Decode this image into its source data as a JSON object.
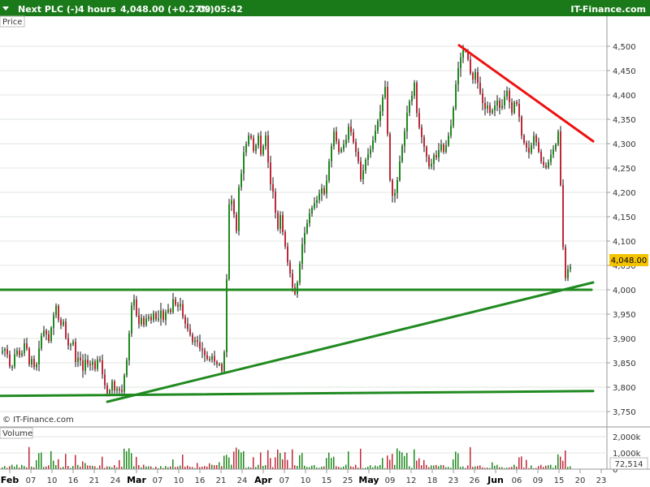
{
  "header": {
    "instrument": "Next PLC (-)",
    "timeframe": "4 hours",
    "last_change": "4,048.00 (+0.27%)",
    "time": "09:05:42",
    "brand": "IT-Finance.com"
  },
  "price_panel_label": "Price",
  "volume_panel_label": "Volume",
  "watermark": "© IT-Finance.com",
  "last_price_label": "4,048.00",
  "last_volume_label": "72,514",
  "price_ticks": [
    "4,500",
    "4,450",
    "4,400",
    "4,350",
    "4,300",
    "4,250",
    "4,200",
    "4,150",
    "4,100",
    "4,050",
    "4,000",
    "3,950",
    "3,900",
    "3,850",
    "3,800",
    "3,750"
  ],
  "volume_ticks": [
    "2,000k",
    "1,000k",
    "0"
  ],
  "x_ticks": [
    {
      "label": "Feb",
      "bold": true
    },
    {
      "label": "07",
      "bold": false
    },
    {
      "label": "10",
      "bold": false
    },
    {
      "label": "16",
      "bold": false
    },
    {
      "label": "21",
      "bold": false
    },
    {
      "label": "24",
      "bold": false
    },
    {
      "label": "Mar",
      "bold": true
    },
    {
      "label": "07",
      "bold": false
    },
    {
      "label": "10",
      "bold": false
    },
    {
      "label": "16",
      "bold": false
    },
    {
      "label": "21",
      "bold": false
    },
    {
      "label": "24",
      "bold": false
    },
    {
      "label": "Apr",
      "bold": true
    },
    {
      "label": "07",
      "bold": false
    },
    {
      "label": "10",
      "bold": false
    },
    {
      "label": "15",
      "bold": false
    },
    {
      "label": "25",
      "bold": false
    },
    {
      "label": "May",
      "bold": true
    },
    {
      "label": "09",
      "bold": false
    },
    {
      "label": "12",
      "bold": false
    },
    {
      "label": "18",
      "bold": false
    },
    {
      "label": "23",
      "bold": false
    },
    {
      "label": "26",
      "bold": false
    },
    {
      "label": "Jun",
      "bold": true
    },
    {
      "label": "06",
      "bold": false
    },
    {
      "label": "09",
      "bold": false
    },
    {
      "label": "15",
      "bold": false
    },
    {
      "label": "20",
      "bold": false
    },
    {
      "label": "23",
      "bold": false
    }
  ],
  "colors": {
    "header_bg": "#1a7a1a",
    "up_candle": "#1e8a1e",
    "down_candle": "#c0283a",
    "trendline_green": "#208a20",
    "trendline_red": "#ee1111",
    "last_price_bg": "#f5c400",
    "grid": "#dfe7df"
  },
  "chart_data": {
    "type": "candlestick",
    "title": "Next PLC (-)",
    "timeframe": "4 hours",
    "y_range": [
      3740,
      4540
    ],
    "volume_range": [
      0,
      2300000
    ],
    "last_price": 4048.0,
    "change_pct": 0.27,
    "last_volume": 72514,
    "grid": true,
    "path_points": [
      [
        0,
        3870
      ],
      [
        8,
        3880
      ],
      [
        14,
        3830
      ],
      [
        20,
        3880
      ],
      [
        26,
        3860
      ],
      [
        32,
        3900
      ],
      [
        36,
        3845
      ],
      [
        40,
        3860
      ],
      [
        44,
        3830
      ],
      [
        48,
        3875
      ],
      [
        52,
        3910
      ],
      [
        56,
        3920
      ],
      [
        60,
        3890
      ],
      [
        66,
        3945
      ],
      [
        70,
        3970
      ],
      [
        74,
        3920
      ],
      [
        78,
        3940
      ],
      [
        82,
        3895
      ],
      [
        86,
        3880
      ],
      [
        90,
        3900
      ],
      [
        94,
        3845
      ],
      [
        98,
        3870
      ],
      [
        102,
        3830
      ],
      [
        106,
        3860
      ],
      [
        110,
        3840
      ],
      [
        114,
        3855
      ],
      [
        118,
        3835
      ],
      [
        122,
        3870
      ],
      [
        126,
        3830
      ],
      [
        130,
        3800
      ],
      [
        134,
        3780
      ],
      [
        138,
        3815
      ],
      [
        142,
        3790
      ],
      [
        146,
        3800
      ],
      [
        150,
        3785
      ],
      [
        154,
        3830
      ],
      [
        158,
        3870
      ],
      [
        161,
        3950
      ],
      [
        164,
        3985
      ],
      [
        167,
        3975
      ],
      [
        170,
        3920
      ],
      [
        174,
        3945
      ],
      [
        178,
        3925
      ],
      [
        182,
        3950
      ],
      [
        186,
        3935
      ],
      [
        190,
        3955
      ],
      [
        194,
        3930
      ],
      [
        198,
        3960
      ],
      [
        202,
        3935
      ],
      [
        206,
        3965
      ],
      [
        210,
        3950
      ],
      [
        214,
        3985
      ],
      [
        218,
        3960
      ],
      [
        222,
        3975
      ],
      [
        226,
        3940
      ],
      [
        230,
        3925
      ],
      [
        234,
        3910
      ],
      [
        238,
        3890
      ],
      [
        242,
        3900
      ],
      [
        246,
        3880
      ],
      [
        250,
        3875
      ],
      [
        254,
        3860
      ],
      [
        258,
        3855
      ],
      [
        262,
        3865
      ],
      [
        266,
        3845
      ],
      [
        270,
        3850
      ],
      [
        274,
        3830
      ],
      [
        277,
        3880
      ],
      [
        280,
        4050
      ],
      [
        283,
        4200
      ],
      [
        286,
        4180
      ],
      [
        289,
        4150
      ],
      [
        292,
        4115
      ],
      [
        295,
        4230
      ],
      [
        298,
        4240
      ],
      [
        301,
        4290
      ],
      [
        304,
        4300
      ],
      [
        307,
        4320
      ],
      [
        310,
        4310
      ],
      [
        313,
        4280
      ],
      [
        316,
        4300
      ],
      [
        319,
        4320
      ],
      [
        322,
        4270
      ],
      [
        325,
        4300
      ],
      [
        328,
        4320
      ],
      [
        331,
        4250
      ],
      [
        334,
        4210
      ],
      [
        337,
        4200
      ],
      [
        340,
        4150
      ],
      [
        343,
        4120
      ],
      [
        346,
        4160
      ],
      [
        349,
        4110
      ],
      [
        352,
        4085
      ],
      [
        355,
        4050
      ],
      [
        358,
        4030
      ],
      [
        361,
        4000
      ],
      [
        364,
        3990
      ],
      [
        367,
        4020
      ],
      [
        370,
        4060
      ],
      [
        373,
        4100
      ],
      [
        376,
        4120
      ],
      [
        379,
        4140
      ],
      [
        382,
        4160
      ],
      [
        385,
        4170
      ],
      [
        388,
        4180
      ],
      [
        391,
        4185
      ],
      [
        394,
        4200
      ],
      [
        397,
        4210
      ],
      [
        400,
        4195
      ],
      [
        403,
        4230
      ],
      [
        406,
        4270
      ],
      [
        409,
        4300
      ],
      [
        412,
        4330
      ],
      [
        415,
        4300
      ],
      [
        418,
        4280
      ],
      [
        421,
        4290
      ],
      [
        424,
        4300
      ],
      [
        427,
        4310
      ],
      [
        430,
        4340
      ],
      [
        433,
        4320
      ],
      [
        436,
        4300
      ],
      [
        439,
        4280
      ],
      [
        442,
        4260
      ],
      [
        445,
        4220
      ],
      [
        448,
        4250
      ],
      [
        451,
        4270
      ],
      [
        454,
        4280
      ],
      [
        457,
        4290
      ],
      [
        460,
        4310
      ],
      [
        463,
        4330
      ],
      [
        466,
        4350
      ],
      [
        469,
        4370
      ],
      [
        472,
        4400
      ],
      [
        475,
        4420
      ],
      [
        478,
        4300
      ],
      [
        481,
        4210
      ],
      [
        484,
        4190
      ],
      [
        487,
        4200
      ],
      [
        490,
        4230
      ],
      [
        493,
        4270
      ],
      [
        496,
        4300
      ],
      [
        499,
        4330
      ],
      [
        502,
        4370
      ],
      [
        505,
        4390
      ],
      [
        508,
        4400
      ],
      [
        511,
        4430
      ],
      [
        514,
        4350
      ],
      [
        517,
        4330
      ],
      [
        520,
        4310
      ],
      [
        523,
        4290
      ],
      [
        526,
        4270
      ],
      [
        529,
        4250
      ],
      [
        532,
        4260
      ],
      [
        535,
        4280
      ],
      [
        538,
        4270
      ],
      [
        541,
        4290
      ],
      [
        544,
        4300
      ],
      [
        547,
        4280
      ],
      [
        550,
        4300
      ],
      [
        553,
        4320
      ],
      [
        556,
        4340
      ],
      [
        559,
        4380
      ],
      [
        562,
        4430
      ],
      [
        565,
        4460
      ],
      [
        568,
        4480
      ],
      [
        571,
        4495
      ],
      [
        574,
        4490
      ],
      [
        577,
        4470
      ],
      [
        580,
        4440
      ],
      [
        583,
        4430
      ],
      [
        586,
        4450
      ],
      [
        589,
        4420
      ],
      [
        592,
        4400
      ],
      [
        595,
        4380
      ],
      [
        598,
        4370
      ],
      [
        601,
        4380
      ],
      [
        604,
        4360
      ],
      [
        607,
        4370
      ],
      [
        610,
        4380
      ],
      [
        613,
        4390
      ],
      [
        616,
        4370
      ],
      [
        619,
        4380
      ],
      [
        622,
        4400
      ],
      [
        625,
        4410
      ],
      [
        628,
        4380
      ],
      [
        631,
        4360
      ],
      [
        634,
        4390
      ],
      [
        637,
        4380
      ],
      [
        640,
        4350
      ],
      [
        643,
        4310
      ],
      [
        646,
        4300
      ],
      [
        649,
        4290
      ],
      [
        652,
        4280
      ],
      [
        655,
        4300
      ],
      [
        658,
        4320
      ],
      [
        661,
        4300
      ],
      [
        664,
        4280
      ],
      [
        667,
        4260
      ],
      [
        670,
        4255
      ],
      [
        673,
        4250
      ],
      [
        676,
        4265
      ],
      [
        679,
        4280
      ],
      [
        682,
        4290
      ],
      [
        685,
        4300
      ],
      [
        688,
        4330
      ],
      [
        690,
        4240
      ],
      [
        692,
        4140
      ],
      [
        694,
        4070
      ],
      [
        696,
        4020
      ],
      [
        698,
        4035
      ],
      [
        700,
        4045
      ],
      [
        703,
        4048
      ]
    ],
    "trend_lines": [
      {
        "color": "red",
        "from": {
          "x": 565,
          "y": 4502
        },
        "to": {
          "x": 730,
          "y": 4305
        }
      },
      {
        "color": "green",
        "from": {
          "x": 0,
          "y": 4000
        },
        "to": {
          "x": 728,
          "y": 4000
        }
      },
      {
        "color": "green",
        "from": {
          "x": 132,
          "y": 3770
        },
        "to": {
          "x": 730,
          "y": 4015
        }
      },
      {
        "color": "green",
        "from": {
          "x": 0,
          "y": 3782
        },
        "to": {
          "x": 730,
          "y": 3792
        }
      }
    ]
  }
}
